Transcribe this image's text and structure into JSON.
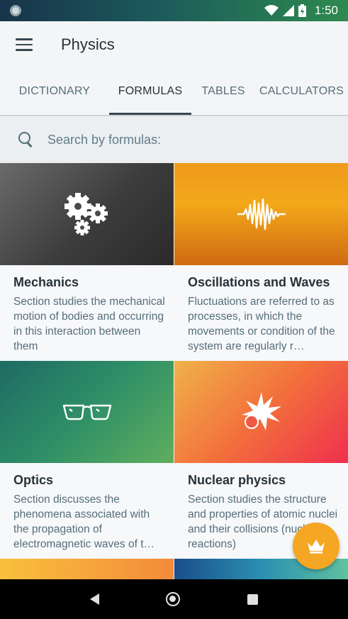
{
  "status": {
    "time": "1:50"
  },
  "app": {
    "title": "Physics"
  },
  "tabs": [
    {
      "label": "DICTIONARY",
      "active": false
    },
    {
      "label": "FORMULAS",
      "active": true
    },
    {
      "label": "TABLES",
      "active": false
    },
    {
      "label": "CALCULATORS",
      "active": false
    }
  ],
  "search": {
    "placeholder": "Search by formulas:",
    "value": ""
  },
  "cards": [
    {
      "title": "Mechanics",
      "description": "Section studies the mechanical motion of bodies and occurring in this interaction between them",
      "icon": "gears-icon"
    },
    {
      "title": "Oscillations and Waves",
      "description": "Fluctuations are referred to as processes, in which the movements or condition of the system are regularly r…",
      "icon": "wave-icon"
    },
    {
      "title": "Optics",
      "description": "Section discusses the phenomena associated with the propagation of electromagnetic waves of t…",
      "icon": "glasses-icon"
    },
    {
      "title": "Nuclear physics",
      "description": "Section studies the structure and properties of atomic nuclei and their collisions (nuclear reactions)",
      "icon": "explosion-icon"
    }
  ],
  "fab": {
    "icon": "crown-icon",
    "color": "#f5a623"
  },
  "colors": {
    "accent": "#f5a623",
    "tab_indicator": "#37474f"
  }
}
